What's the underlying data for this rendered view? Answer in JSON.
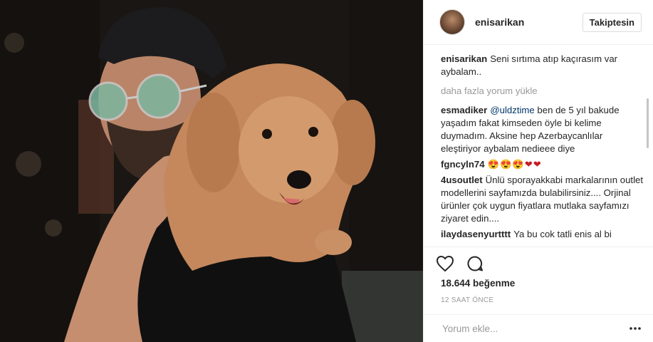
{
  "post": {
    "photo_alt_icon": "photo-man-with-poodle",
    "author": {
      "username": "enisarikan",
      "follow_label": "Takiptesin"
    },
    "caption": {
      "user": "enisarikan",
      "text": "Seni sırtıma atıp kaçırasım var aybalam.."
    },
    "load_more_label": "daha fazla yorum yükle",
    "comments": [
      {
        "user": "esmadiker",
        "mention": "@uldztime",
        "text": " ben de 5 yıl bakude yaşadım fakat kimseden öyle bi kelime duymadım. Aksine hep Azerbaycanlılar eleştiriyor aybalam nedieee diye"
      },
      {
        "user": "fgncyln74",
        "mention": "",
        "text": "😍😍😍❤❤"
      },
      {
        "user": "4usoutlet",
        "mention": "",
        "text": "Ünlü sporayakkabi markalarının outlet modellerini sayfamızda bulabilirsiniz.... Orjinal ürünler çok uygun fiyatlara mutlaka sayfamızı ziyaret edin...."
      },
      {
        "user": "ilaydasenyurtttt",
        "mention": "",
        "text": "Ya bu cok tatli enis al bi"
      }
    ],
    "actions": {
      "like_icon": "heart-icon",
      "comment_icon": "comment-icon"
    },
    "likes_label": "18.644 beğenme",
    "time_label": "12 SAAT ÖNCE",
    "comment_placeholder": "Yorum ekle...",
    "more_icon": "more-options-icon"
  }
}
